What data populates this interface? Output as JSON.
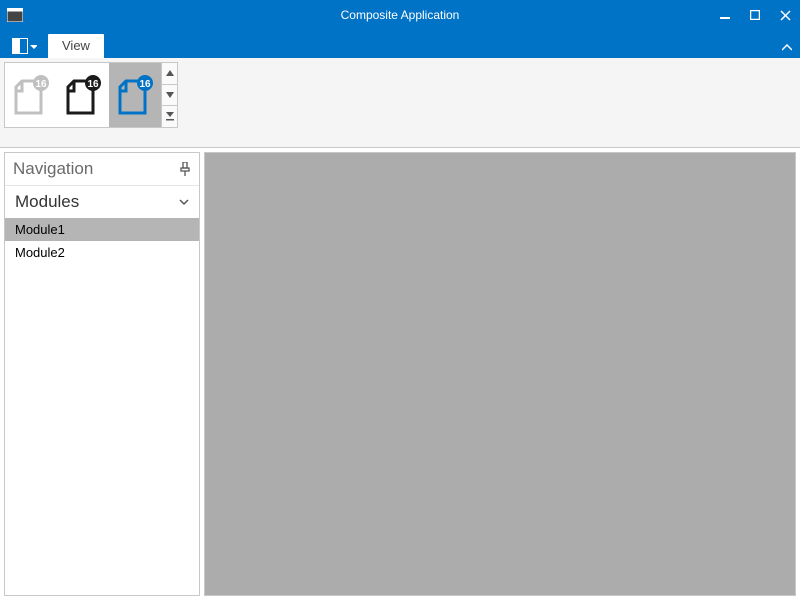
{
  "window": {
    "title": "Composite Application"
  },
  "ribbon": {
    "tabs": {
      "view": "View"
    },
    "gallery": {
      "badge": "16",
      "item_names": [
        "theme-light",
        "theme-dark",
        "theme-blue"
      ]
    }
  },
  "navigation": {
    "header": "Navigation",
    "group": "Modules",
    "items": [
      "Module1",
      "Module2"
    ]
  },
  "colors": {
    "accent": "#0173c7",
    "selection": "#b5b5b5",
    "workspace": "#acacac"
  }
}
